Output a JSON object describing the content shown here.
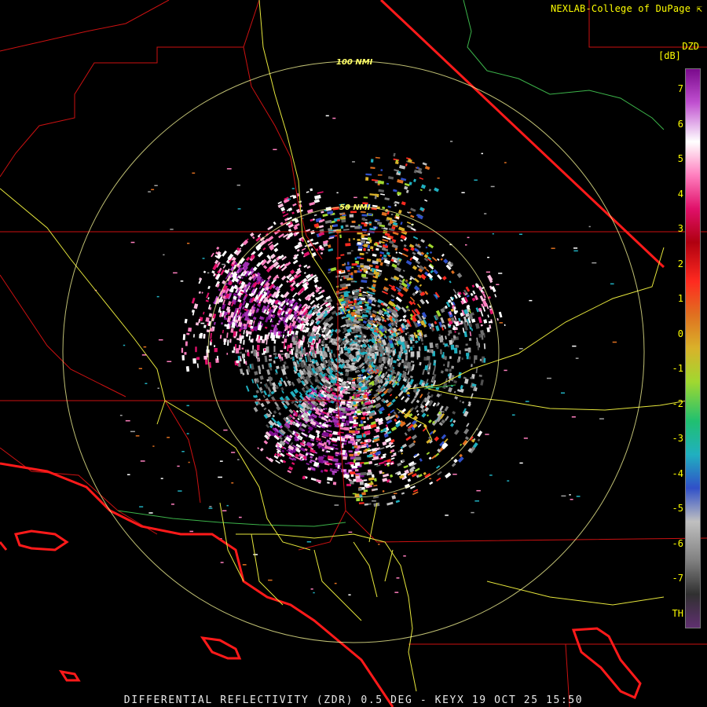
{
  "header": {
    "credit": "NEXLAB-College of DuPage",
    "credit_icon": "cursor-icon"
  },
  "legend": {
    "product": "DZD",
    "unit": "[dB]",
    "ticks": [
      "7",
      "6",
      "5",
      "4",
      "3",
      "2",
      "1",
      "0",
      "-1",
      "-2",
      "-3",
      "-4",
      "-5",
      "-6",
      "-7",
      "TH"
    ],
    "colors": [
      "#7a0a8c",
      "#c050d0",
      "#ffffff",
      "#ff7fbf",
      "#e0106a",
      "#b00010",
      "#ff2a20",
      "#e07020",
      "#d9b22a",
      "#a0d830",
      "#20c070",
      "#20b0c0",
      "#3050c8",
      "#c0c0c0",
      "#808080",
      "#303030",
      "#603070"
    ]
  },
  "rings": {
    "inner_label": "50 NMI",
    "outer_label": "100 NMI"
  },
  "footer": {
    "caption": "DIFFERENTIAL REFLECTIVITY (ZDR) 0.5 DEG - KEYX 19 OCT 25 15:50"
  },
  "colors": {
    "text_yellow": "#ffff00",
    "borders": "#cc1111",
    "coast": "#ff1a1a",
    "roads": "#e6e63c",
    "rivers": "#3cb44a",
    "rings": "#ffff99"
  }
}
